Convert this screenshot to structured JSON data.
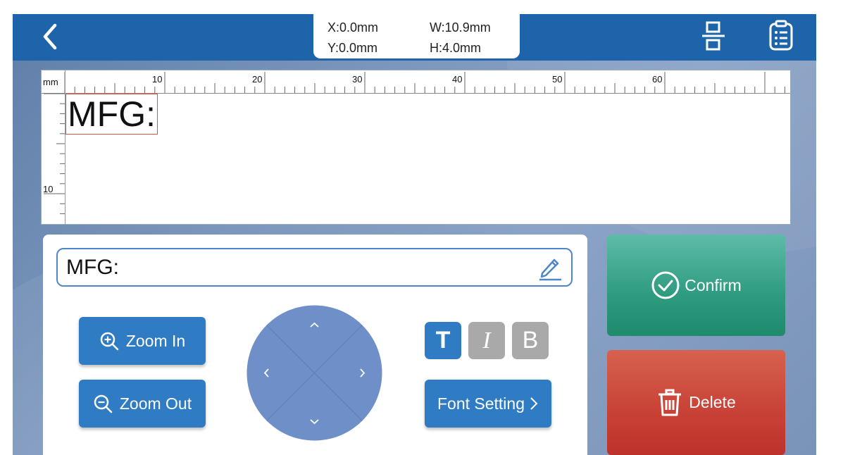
{
  "header": {
    "x_readout": "X:0.0mm",
    "y_readout": "Y:0.0mm",
    "w_readout": "W:10.9mm",
    "h_readout": "H:4.0mm"
  },
  "canvas": {
    "unit_label": "mm",
    "h_ruler_labels": [
      "10",
      "20",
      "30",
      "40",
      "50",
      "60"
    ],
    "v_ruler_labels": [
      "10"
    ],
    "text_object": "MFG:"
  },
  "editor": {
    "text_value": "MFG:",
    "zoom_in_label": "Zoom In",
    "zoom_out_label": "Zoom Out",
    "font_setting_label": "Font Setting",
    "style_buttons": {
      "text": "T",
      "italic": "I",
      "bold": "B"
    }
  },
  "actions": {
    "confirm_label": "Confirm",
    "delete_label": "Delete"
  },
  "colors": {
    "header": "#1e64aa",
    "button_blue": "#2f7cc4",
    "confirm_green": "#2e9b7f",
    "delete_red": "#c84136",
    "dpad": "#6f8fc8",
    "style_inactive": "#a9a9a9",
    "selection_border": "#e0533b"
  },
  "icons": [
    "back-icon",
    "align-icon",
    "list-icon",
    "edit-icon",
    "zoom-in-icon",
    "zoom-out-icon",
    "chevron-right-icon",
    "confirm-check-icon",
    "trash-icon",
    "arrow-up-icon",
    "arrow-down-icon",
    "arrow-left-icon",
    "arrow-right-icon"
  ]
}
